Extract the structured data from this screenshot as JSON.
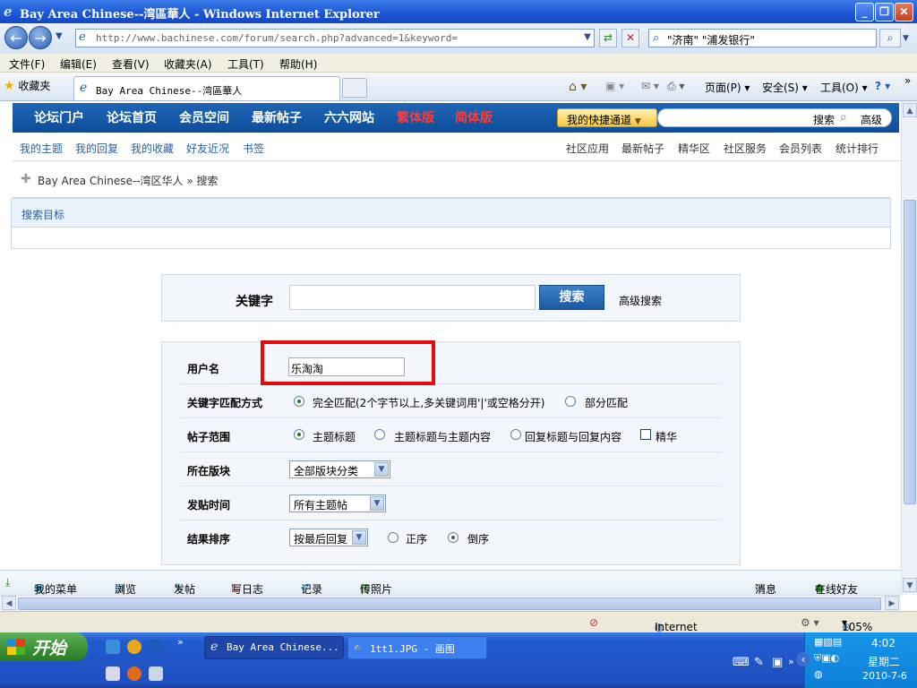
{
  "window": {
    "title": "Bay Area Chinese--湾區華人 - Windows Internet Explorer"
  },
  "address": {
    "url": "http://www.bachinese.com/forum/search.php?advanced=1&keyword="
  },
  "search_box": {
    "value": "\"济南\" \"浦发银行\""
  },
  "menu": [
    "文件(F)",
    "编辑(E)",
    "查看(V)",
    "收藏夹(A)",
    "工具(T)",
    "帮助(H)"
  ],
  "favbar": {
    "favorites": "收藏夹",
    "tab_title": "Bay Area Chinese--湾區華人",
    "tools": {
      "page": "页面(P)",
      "safety": "安全(S)",
      "tools": "工具(O)"
    }
  },
  "site_nav": {
    "items": [
      "论坛门户",
      "论坛首页",
      "会员空间",
      "最新帖子",
      "六六网站",
      "繁体版",
      "简体版"
    ],
    "quick": "我的快捷通道",
    "search": "搜索",
    "advanced": "高级"
  },
  "sub_nav": {
    "left": [
      "我的主题",
      "我的回复",
      "我的收藏",
      "好友近况",
      "书签"
    ],
    "right": [
      "社区应用",
      "最新帖子",
      "精华区",
      "社区服务",
      "会员列表",
      "统计排行"
    ]
  },
  "breadcrumb": {
    "site": "Bay Area Chinese--湾区华人",
    "sep": "»",
    "current": "搜索"
  },
  "panel_title": "搜索目标",
  "keyword": {
    "label": "关键字",
    "value": "",
    "button": "搜索",
    "advanced": "高级搜索"
  },
  "form": {
    "username": {
      "label": "用户名",
      "value": "乐淘淘"
    },
    "match": {
      "label": "关键字匹配方式",
      "options": [
        "完全匹配(2个字节以上,多关键词用'|'或空格分开)",
        "部分匹配"
      ],
      "selected": 0
    },
    "scope": {
      "label": "帖子范围",
      "options": [
        "主题标题",
        "主题标题与主题内容",
        "回复标题与回复内容"
      ],
      "selected": 0,
      "checkbox": "精华",
      "checkbox_checked": false
    },
    "board": {
      "label": "所在版块",
      "value": "全部版块分类"
    },
    "time": {
      "label": "发贴时间",
      "value": "所有主题帖"
    },
    "sort": {
      "label": "结果排序",
      "value": "按最后回复",
      "options": [
        "正序",
        "倒序"
      ],
      "selected": 1
    }
  },
  "bottom_bar": {
    "items": [
      "我的菜单",
      "浏览",
      "发帖",
      "写日志",
      "记录",
      "传照片"
    ],
    "right": [
      "消息",
      "在线好友"
    ]
  },
  "status_bar": {
    "zone": "Internet",
    "zoom": "105%"
  },
  "taskbar": {
    "start": "开始",
    "tasks": [
      "Bay Area Chinese...",
      "1tt1.JPG - 画图"
    ],
    "clock": {
      "time": "4:02",
      "day": "星期二",
      "date": "2010-7-6"
    }
  }
}
